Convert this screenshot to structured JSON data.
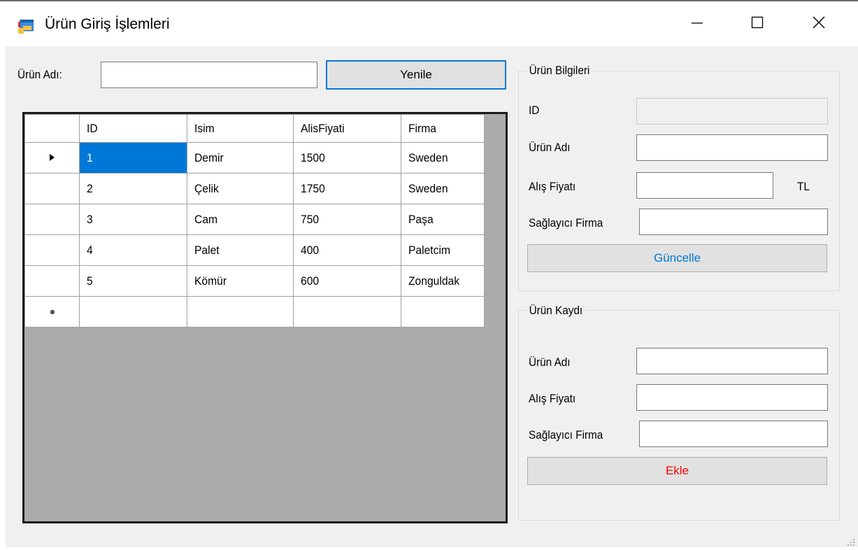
{
  "window": {
    "title": "Ürün Giriş İşlemleri",
    "icon": "form-app-icon",
    "controls": [
      "minimize-icon",
      "maximize-icon",
      "close-icon"
    ]
  },
  "search": {
    "label": "Ürün Adı:",
    "value": "",
    "refresh_button": "Yenile"
  },
  "grid": {
    "columns": [
      "ID",
      "Isim",
      "AlisFiyati",
      "Firma"
    ],
    "rows": [
      {
        "id": "1",
        "name": "Demir",
        "price": "1500",
        "firm": "Sweden"
      },
      {
        "id": "2",
        "name": "Çelik",
        "price": "1750",
        "firm": "Sweden"
      },
      {
        "id": "3",
        "name": "Cam",
        "price": "750",
        "firm": "Paşa"
      },
      {
        "id": "4",
        "name": "Palet",
        "price": "400",
        "firm": "Paletcim"
      },
      {
        "id": "5",
        "name": "Kömür",
        "price": "600",
        "firm": "Zonguldak"
      }
    ],
    "selected_row": 0,
    "current_row_marker": "▶",
    "new_row_marker": "✱"
  },
  "info_group": {
    "title": "Ürün Bilgileri",
    "id_label": "ID",
    "id_value": "",
    "name_label": "Ürün Adı",
    "name_value": "",
    "price_label": "Alış Fiyatı",
    "price_value": "",
    "currency": "TL",
    "supplier_label": "Sağlayıcı Firma",
    "supplier_value": "",
    "update_button": "Güncelle",
    "update_color": "#0078d7"
  },
  "record_group": {
    "title": "Ürün Kaydı",
    "name_label": "Ürün Adı",
    "name_value": "",
    "price_label": "Alış Fiyatı",
    "price_value": "",
    "supplier_label": "Sağlayıcı Firma",
    "supplier_value": "",
    "add_button": "Ekle",
    "add_color": "#ff0000"
  }
}
